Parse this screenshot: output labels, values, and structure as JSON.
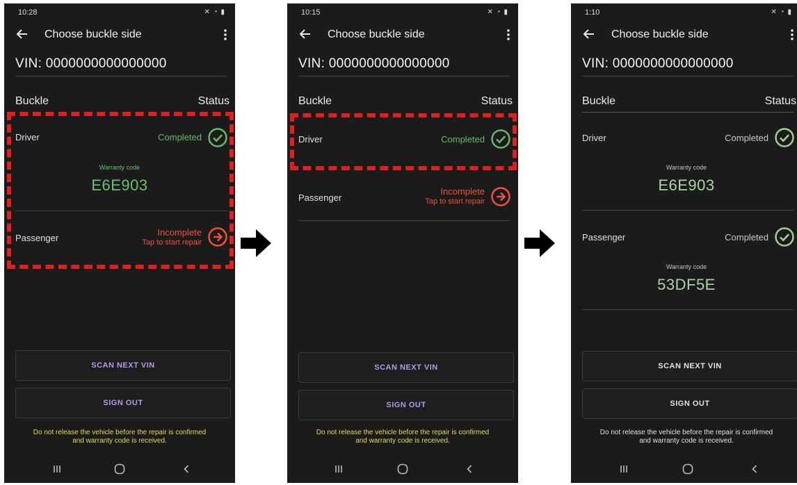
{
  "screens": [
    {
      "status_time": "10:28",
      "title": "Choose buckle side",
      "vin": "VIN: 0000000000000000",
      "col_buckle": "Buckle",
      "col_status": "Status",
      "driver": {
        "label": "Driver",
        "status": "Completed",
        "warranty_label": "Warranty code",
        "warranty_code": "E6E903"
      },
      "passenger": {
        "label": "Passenger",
        "status": "Incomplete",
        "sub": "Tap to start repair"
      },
      "btn_scan": "SCAN NEXT VIN",
      "btn_signout": "SIGN OUT",
      "notice_line1": "Do not release the vehicle before the repair is confirmed",
      "notice_line2": "and warranty code is received."
    },
    {
      "status_time": "10:15",
      "title": "Choose buckle side",
      "vin": "VIN: 0000000000000000",
      "col_buckle": "Buckle",
      "col_status": "Status",
      "driver": {
        "label": "Driver",
        "status": "Completed"
      },
      "passenger": {
        "label": "Passenger",
        "status": "Incomplete",
        "sub": "Tap to start repair"
      },
      "btn_scan": "SCAN NEXT VIN",
      "btn_signout": "SIGN OUT",
      "notice_line1": "Do not release the vehicle before the repair is confirmed",
      "notice_line2": "and warranty code is received."
    },
    {
      "status_time": "1:10",
      "title": "Choose buckle side",
      "vin": "VIN: 0000000000000000",
      "col_buckle": "Buckle",
      "col_status": "Status",
      "driver": {
        "label": "Driver",
        "status": "Completed",
        "warranty_label": "Warranty code",
        "warranty_code": "E6E903"
      },
      "passenger": {
        "label": "Passenger",
        "status": "Completed",
        "warranty_label": "Warranty code",
        "warranty_code": "53DF5E"
      },
      "btn_scan": "SCAN NEXT VIN",
      "btn_signout": "SIGN OUT",
      "notice_line1": "Do not release the vehicle before the repair is confirmed",
      "notice_line2": "and warranty code is received."
    }
  ],
  "colors": {
    "highlight": "#e02020",
    "completed": "#66b966",
    "incomplete": "#f0503c",
    "notice": "#e8d85a",
    "button_text": "#b79ae8"
  },
  "icons": [
    "back-arrow-icon",
    "more-vert-icon",
    "check-circle-icon",
    "arrow-circle-right-icon",
    "flow-arrow-icon",
    "recents-icon",
    "home-icon",
    "back-nav-icon"
  ]
}
